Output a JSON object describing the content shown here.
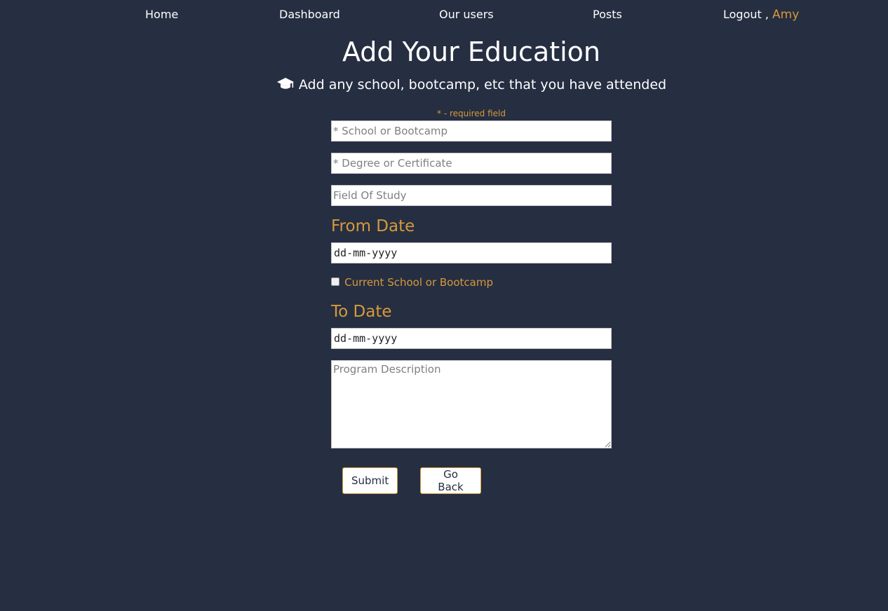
{
  "nav": {
    "home": "Home",
    "dashboard": "Dashboard",
    "users": "Our users",
    "posts": "Posts",
    "logout": "Logout",
    "separator": " , ",
    "username": "Amy"
  },
  "page": {
    "title": "Add Your Education",
    "subtitle": "Add any school, bootcamp, etc that you have attended",
    "subtitle_icon": "graduation-cap-icon",
    "required_note": "* - required field"
  },
  "form": {
    "school_placeholder": "* School or Bootcamp",
    "school_value": "",
    "degree_placeholder": "* Degree or Certificate",
    "degree_value": "",
    "field_of_study_placeholder": "Field Of Study",
    "field_of_study_value": "",
    "from_label": "From Date",
    "from_value": "dd-mm-yyyy",
    "current_label": "Current School or Bootcamp",
    "current_checked": false,
    "to_label": "To Date",
    "to_value": "dd-mm-yyyy",
    "description_placeholder": "Program Description",
    "description_value": "",
    "submit_label": "Submit",
    "back_label": "Go Back"
  },
  "colors": {
    "background": "#262e42",
    "accent": "#d59a3a",
    "text": "#ffffff"
  }
}
